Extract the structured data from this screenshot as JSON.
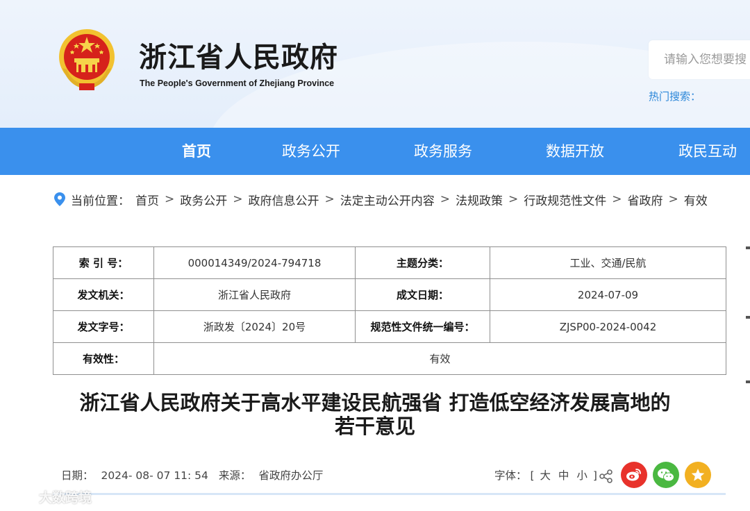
{
  "header": {
    "site_title": "浙江省人民政府",
    "site_subtitle": "The People's Government of Zhejiang Province",
    "search_placeholder": "请输入您想要搜",
    "hot_search_label": "热门搜索："
  },
  "nav": {
    "items": [
      {
        "label": "首页",
        "active": true
      },
      {
        "label": "政务公开",
        "active": false
      },
      {
        "label": "政务服务",
        "active": false
      },
      {
        "label": "数据开放",
        "active": false
      },
      {
        "label": "政民互动",
        "active": false
      }
    ]
  },
  "breadcrumb": {
    "prefix": "当前位置：",
    "items": [
      "首页",
      "政务公开",
      "政府信息公开",
      "法定主动公开内容",
      "法规政策",
      "行政规范性文件",
      "省政府",
      "有效"
    ],
    "separator": ">"
  },
  "info_table": {
    "rows": [
      {
        "l1": "索 引 号：",
        "v1": "000014349/2024-794718",
        "l2": "主题分类：",
        "v2": "工业、交通/民航"
      },
      {
        "l1": "发文机关：",
        "v1": "浙江省人民政府",
        "l2": "成文日期：",
        "v2": "2024-07-09"
      },
      {
        "l1": "发文字号：",
        "v1": "浙政发〔2024〕20号",
        "l2": "规范性文件统一编号：",
        "v2": "ZJSP00-2024-0042"
      },
      {
        "l1": "有效性：",
        "v1": "有效"
      }
    ]
  },
  "article": {
    "title_line1": "浙江省人民政府关于高水平建设民航强省 打造低空经济发展高地的",
    "title_line2": "若干意见"
  },
  "meta": {
    "date_label": "日期：",
    "date_value": "2024- 08- 07 11: 54",
    "source_label": "来源：",
    "source_value": "省政府办公厅",
    "font_label": "字体：",
    "font_open": "[",
    "font_large": "大",
    "font_medium": "中",
    "font_small": "小",
    "font_close": "]"
  },
  "watermark": {
    "text": "大数跨境"
  },
  "colors": {
    "nav_bg": "#3a90ed",
    "hot_search": "#2a86d8",
    "weibo": "#e8322b",
    "wechat": "#4ab841",
    "favorite": "#f2b021"
  }
}
